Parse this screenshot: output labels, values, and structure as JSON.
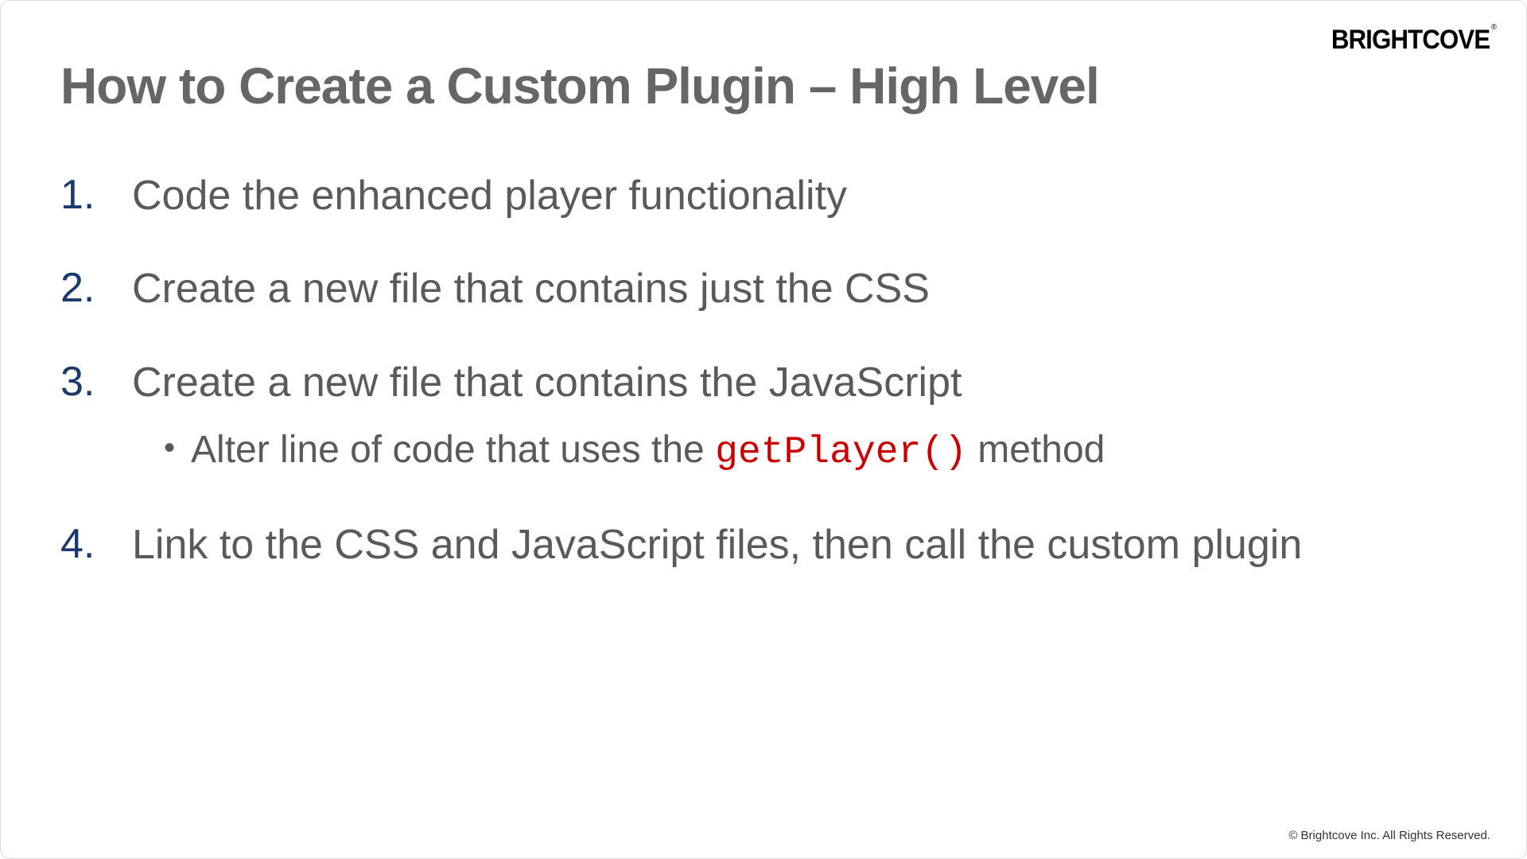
{
  "logo": "BRIGHTCOVE",
  "title": "How to Create a Custom Plugin – High Level",
  "items": [
    {
      "number": "1.",
      "text": "Code the enhanced player functionality"
    },
    {
      "number": "2.",
      "text": "Create a new file that contains just the CSS"
    },
    {
      "number": "3.",
      "text": "Create a new file that contains the JavaScript",
      "sub": {
        "prefix": "Alter line of code that uses the ",
        "code": "getPlayer()",
        "suffix": " method"
      }
    },
    {
      "number": "4.",
      "text": "Link to the CSS and JavaScript files, then call the custom plugin"
    }
  ],
  "copyright": "© Brightcove Inc. All Rights Reserved."
}
